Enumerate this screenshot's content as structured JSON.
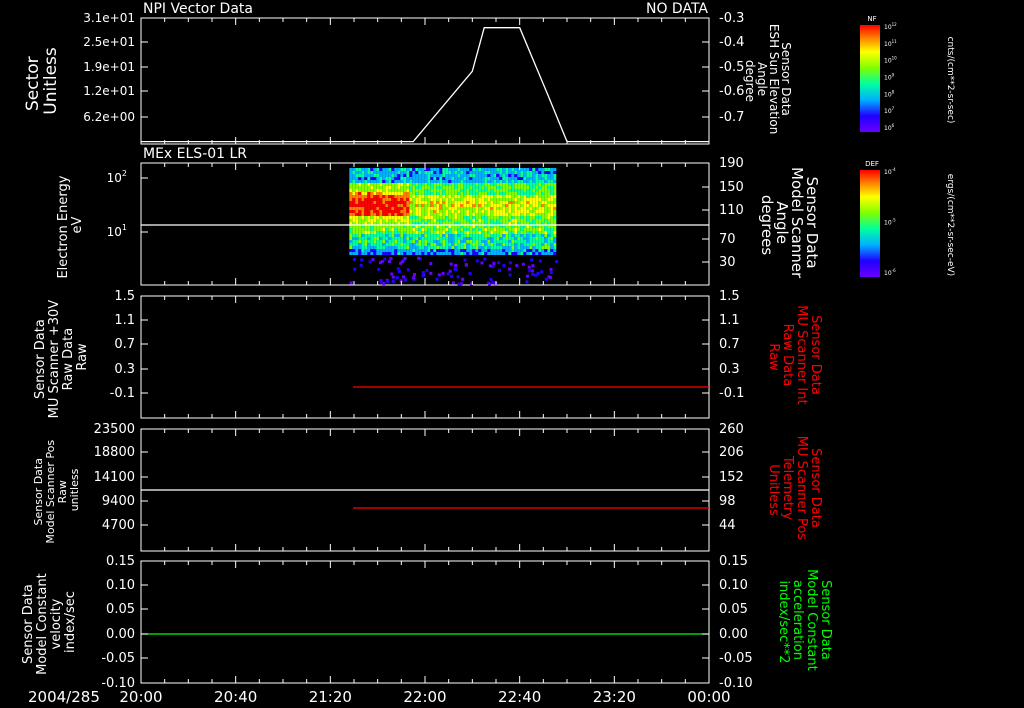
{
  "chart_data": [
    {
      "type": "line",
      "panel_title_left": "NPI Vector Data",
      "panel_title_right": "NO DATA",
      "ylabel_left": [
        "Sector",
        "Unitless"
      ],
      "ylabel_right": [
        "Sensor Data",
        "ESH Sun Elevation",
        "Angle",
        "degree"
      ],
      "left_ticks": [
        "3.1e+01",
        "2.5e+01",
        "1.9e+01",
        "1.2e+01",
        "6.2e+00"
      ],
      "right_ticks": [
        "-0.3",
        "-0.4",
        "-0.5",
        "-0.6",
        "-0.7"
      ],
      "right_ylim": [
        -0.28,
        -0.8
      ],
      "series": [
        {
          "color": "#ffffff",
          "x": [
            "20:00",
            "21:55",
            "22:20",
            "22:25",
            "22:35",
            "22:40",
            "22:52",
            "23:00",
            "00:00"
          ],
          "values": [
            -0.79,
            -0.79,
            -0.5,
            -0.32,
            -0.32,
            -0.32,
            -0.6,
            -0.79,
            -0.79
          ]
        }
      ]
    },
    {
      "type": "heatmap",
      "panel_title_left": "MEx ELS-01 LR",
      "ylabel_left": [
        "Electron Energy",
        "eV"
      ],
      "ylabel_right": [
        "Sensor Data",
        "Model Scanner",
        "Angle",
        "degrees"
      ],
      "left_ticks": [
        "10",
        "10"
      ],
      "left_tick_sup": [
        "2",
        "1"
      ],
      "right_ticks": [
        "190",
        "150",
        "110",
        "70",
        "30"
      ],
      "spectrogram_x_range": [
        "21:28",
        "22:55"
      ],
      "series": [
        {
          "color": "#ffffff",
          "constant_value": 90
        }
      ]
    },
    {
      "type": "line",
      "ylabel_left": [
        "Sensor Data",
        "MU Scanner +30V",
        "Raw Data",
        "Raw"
      ],
      "ylabel_right": [
        "Sensor Data",
        "MU Scanner Int",
        "Raw Data",
        "Raw"
      ],
      "left_ticks": [
        "1.5",
        "1.1",
        "0.7",
        "0.3",
        "-0.1"
      ],
      "right_ticks": [
        "1.5",
        "1.1",
        "0.7",
        "0.3",
        "-0.1"
      ],
      "series": [
        {
          "color": "#ff0000",
          "x_start": "21:27",
          "x_end": "00:00",
          "constant_value": 0.0
        }
      ]
    },
    {
      "type": "line",
      "ylabel_left": [
        "Sensor Data",
        "Model Scanner Pos",
        "Raw",
        "unitless"
      ],
      "ylabel_right": [
        "Sensor Data",
        "MU Scanner Pos",
        "Telemetry",
        "Unitless"
      ],
      "left_ticks": [
        "23500",
        "18800",
        "14100",
        "9400",
        "4700"
      ],
      "right_ticks": [
        "260",
        "206",
        "152",
        "98",
        "44"
      ],
      "series": [
        {
          "color": "#ffffff",
          "x_start": "20:00",
          "x_end": "00:00",
          "constant_value_left": 11700
        },
        {
          "color": "#ff0000",
          "x_start": "21:27",
          "x_end": "00:00",
          "constant_value_right": 90
        }
      ]
    },
    {
      "type": "line",
      "ylabel_left": [
        "Sensor Data",
        "Model Constant",
        "velocity",
        "index/sec"
      ],
      "ylabel_right": [
        "Sensor Data",
        "Model Constant",
        "acceleration",
        "index/sec**2"
      ],
      "left_ticks": [
        "0.15",
        "0.10",
        "0.05",
        "0.00",
        "-0.05",
        "-0.10"
      ],
      "right_ticks": [
        "0.15",
        "0.10",
        "0.05",
        "0.00",
        "-0.05",
        "-0.10"
      ],
      "series": [
        {
          "color": "#00ff00",
          "x_start": "20:00",
          "x_end": "00:00",
          "constant_value": 0.0
        }
      ]
    }
  ],
  "x_axis": {
    "date_label": "2004/285",
    "ticks": [
      "20:00",
      "20:40",
      "21:20",
      "22:00",
      "22:40",
      "23:20",
      "00:00"
    ]
  },
  "colorbars": [
    {
      "title": "NF",
      "units": "cnts/(cm**2-sr-sec)",
      "labels": [
        "10",
        "10",
        "10",
        "10",
        "10",
        "10",
        "10"
      ],
      "sup": [
        "12",
        "11",
        "10",
        "9",
        "8",
        "7",
        "6"
      ]
    },
    {
      "title": "DEF",
      "units": "ergs/(cm**2-sr-sec-eV)",
      "labels": [
        "10",
        "10",
        "10"
      ],
      "sup": [
        "-4",
        "-5",
        "-6"
      ]
    }
  ],
  "colors": {
    "background": "#000000",
    "frame": "#ffffff",
    "red": "#ff0000",
    "green": "#00ff00"
  }
}
